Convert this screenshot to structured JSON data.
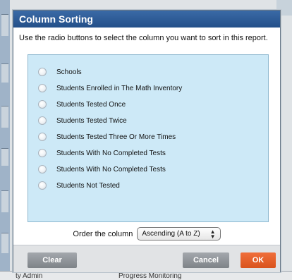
{
  "background": {
    "bottom_text_left": "ty Admin",
    "bottom_text_mid": "Progress Monitoring"
  },
  "dialog": {
    "title": "Column Sorting",
    "instructions": "Use the radio buttons to select the column you want to sort in this report.",
    "options": [
      {
        "label": "Schools",
        "selected": false
      },
      {
        "label": "Students Enrolled in The Math Inventory",
        "selected": false
      },
      {
        "label": "Students Tested Once",
        "selected": false
      },
      {
        "label": "Students Tested Twice",
        "selected": false
      },
      {
        "label": "Students Tested Three Or More Times",
        "selected": false
      },
      {
        "label": "Students With No Completed Tests",
        "selected": false
      },
      {
        "label": "Students With No Completed Tests",
        "selected": false
      },
      {
        "label": "Students Not Tested",
        "selected": false
      }
    ],
    "order_label": "Order the column",
    "order_value": "Ascending (A to Z)",
    "buttons": {
      "clear": "Clear",
      "cancel": "Cancel",
      "ok": "OK"
    },
    "colors": {
      "titlebar": "#2f5d97",
      "list_bg": "#cde9f7",
      "ok_button": "#e8602a",
      "gray_button": "#8f9398"
    }
  }
}
